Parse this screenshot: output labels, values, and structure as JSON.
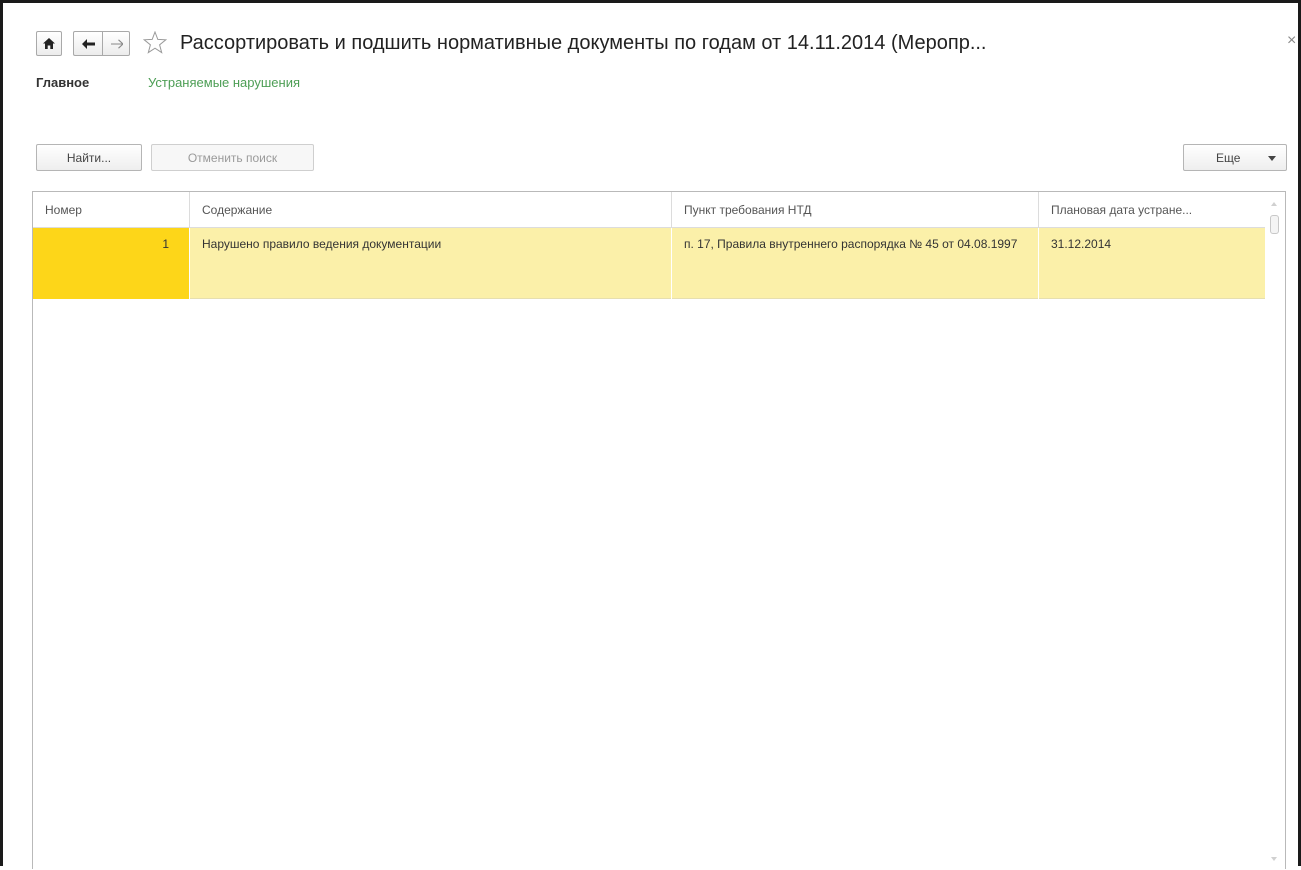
{
  "window": {
    "title": "Рассортировать и подшить нормативные документы по годам от 14.11.2014 (Меропр...",
    "close_glyph": "×"
  },
  "icons": {
    "home": "home-icon",
    "back": "arrow-left-icon",
    "forward": "arrow-right-icon",
    "favorite": "star-icon",
    "close": "close-icon",
    "more_dropdown": "chevron-down-icon"
  },
  "tabs": [
    {
      "label": "Главное",
      "active": true
    },
    {
      "label": "Устраняемые нарушения",
      "active": false
    }
  ],
  "toolbar": {
    "find_label": "Найти...",
    "cancel_search_label": "Отменить поиск",
    "more_label": "Еще"
  },
  "table": {
    "columns": [
      "Номер",
      "Содержание",
      "Пункт требования НТД",
      "Плановая дата устране..."
    ],
    "rows": [
      {
        "number": "1",
        "content": "Нарушено правило ведения документации",
        "requirement": "п. 17, Правила внутреннего распорядка № 45 от 04.08.1997",
        "planned_date": "31.12.2014"
      }
    ]
  },
  "colors": {
    "selected_row": "#fbf0a9",
    "selected_cell": "#fdd619",
    "tab_link": "#4d9e55"
  }
}
